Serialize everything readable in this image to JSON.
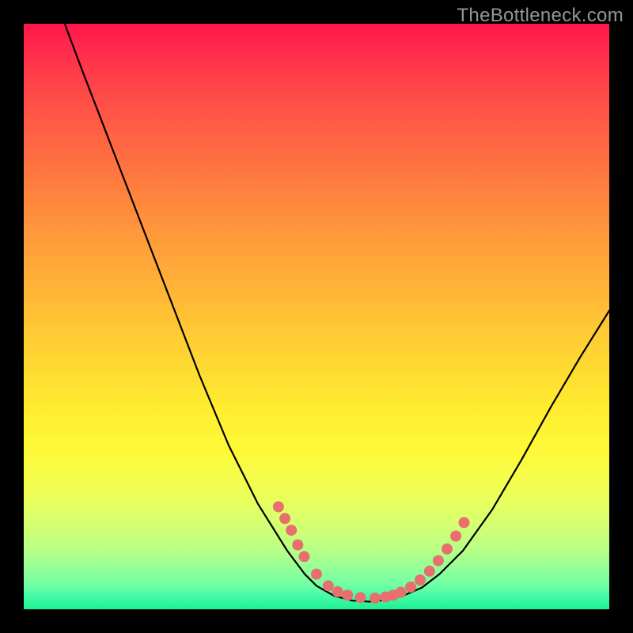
{
  "watermark": "TheBottleneck.com",
  "chart_data": {
    "type": "line",
    "title": "",
    "xlabel": "",
    "ylabel": "",
    "xlim": [
      0,
      100
    ],
    "ylim": [
      0,
      100
    ],
    "curve": {
      "name": "bottleneck-curve",
      "color": "#000000",
      "points": [
        {
          "x": 7.0,
          "y": 100.0
        },
        {
          "x": 10.0,
          "y": 92.0
        },
        {
          "x": 15.0,
          "y": 79.0
        },
        {
          "x": 20.0,
          "y": 66.0
        },
        {
          "x": 25.0,
          "y": 53.0
        },
        {
          "x": 30.0,
          "y": 40.0
        },
        {
          "x": 35.0,
          "y": 28.0
        },
        {
          "x": 40.0,
          "y": 18.0
        },
        {
          "x": 45.0,
          "y": 10.0
        },
        {
          "x": 48.0,
          "y": 6.0
        },
        {
          "x": 50.0,
          "y": 4.0
        },
        {
          "x": 53.0,
          "y": 2.3
        },
        {
          "x": 56.0,
          "y": 1.5
        },
        {
          "x": 59.0,
          "y": 1.3
        },
        {
          "x": 62.0,
          "y": 1.6
        },
        {
          "x": 65.0,
          "y": 2.4
        },
        {
          "x": 68.0,
          "y": 3.7
        },
        {
          "x": 71.0,
          "y": 6.0
        },
        {
          "x": 75.0,
          "y": 10.0
        },
        {
          "x": 80.0,
          "y": 17.0
        },
        {
          "x": 85.0,
          "y": 25.5
        },
        {
          "x": 90.0,
          "y": 34.5
        },
        {
          "x": 95.0,
          "y": 43.0
        },
        {
          "x": 100.0,
          "y": 51.0
        }
      ]
    },
    "markers": {
      "name": "cluster-points",
      "color": "#e86f6d",
      "radius_px": 7,
      "points": [
        {
          "x": 43.5,
          "y": 17.5
        },
        {
          "x": 44.6,
          "y": 15.5
        },
        {
          "x": 45.7,
          "y": 13.5
        },
        {
          "x": 46.8,
          "y": 11.0
        },
        {
          "x": 47.9,
          "y": 9.0
        },
        {
          "x": 50.0,
          "y": 6.0
        },
        {
          "x": 52.0,
          "y": 4.0
        },
        {
          "x": 53.6,
          "y": 3.0
        },
        {
          "x": 55.3,
          "y": 2.4
        },
        {
          "x": 57.5,
          "y": 2.0
        },
        {
          "x": 60.0,
          "y": 1.9
        },
        {
          "x": 61.8,
          "y": 2.1
        },
        {
          "x": 63.1,
          "y": 2.4
        },
        {
          "x": 64.4,
          "y": 2.9
        },
        {
          "x": 66.1,
          "y": 3.8
        },
        {
          "x": 67.7,
          "y": 5.0
        },
        {
          "x": 69.3,
          "y": 6.5
        },
        {
          "x": 70.8,
          "y": 8.3
        },
        {
          "x": 72.3,
          "y": 10.3
        },
        {
          "x": 73.8,
          "y": 12.5
        },
        {
          "x": 75.2,
          "y": 14.8
        }
      ]
    }
  }
}
